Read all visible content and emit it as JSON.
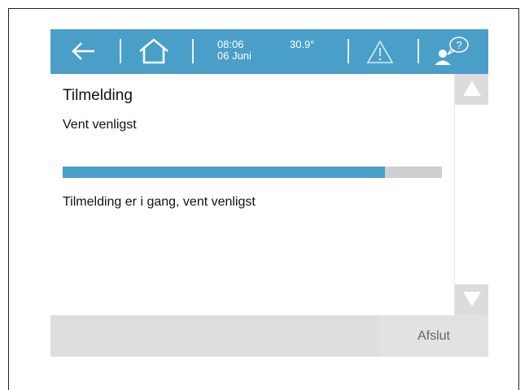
{
  "topbar": {
    "back_icon": "arrow-left-icon",
    "home_icon": "home-icon",
    "time": "08:06",
    "date": "06 Juni",
    "temperature": "30.9°",
    "warning_icon": "warning-triangle-icon",
    "help_icon": "user-help-icon"
  },
  "main": {
    "title": "Tilmelding",
    "subtitle": "Vent venligst",
    "progress_fraction": 0.85,
    "status": "Tilmelding er i gang, vent venligst"
  },
  "scrollbar": {
    "up_icon": "triangle-up-icon",
    "down_icon": "triangle-down-icon"
  },
  "bottom": {
    "exit_label": "Afslut"
  },
  "colors": {
    "accent": "#4a9fc9",
    "track": "#cfcfcf",
    "bar_bg": "#dedede"
  }
}
